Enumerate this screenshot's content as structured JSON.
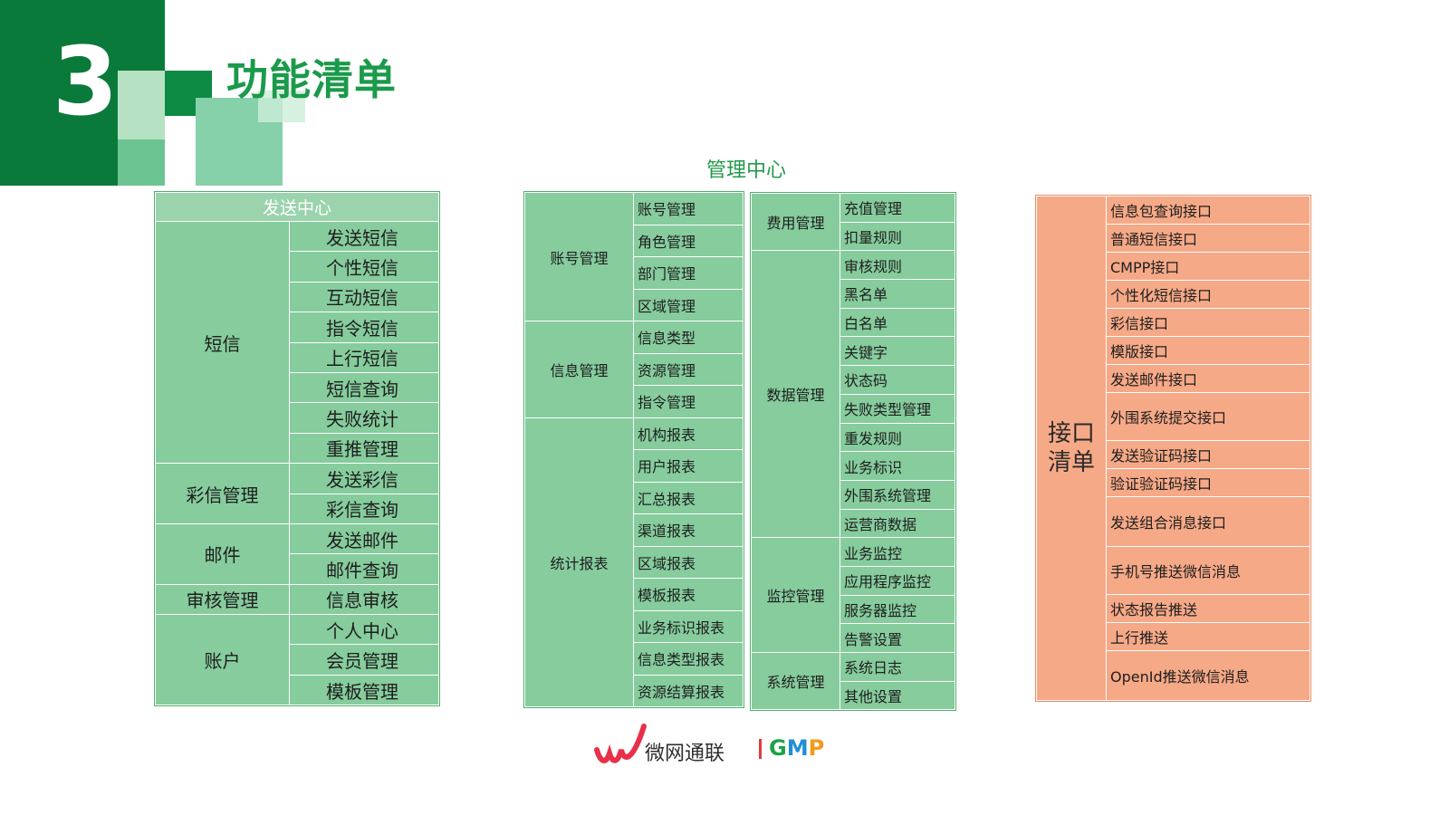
{
  "section_number": "3",
  "title": "功能清单",
  "send_center": {
    "header": "发送中心",
    "groups": [
      {
        "category": "短信",
        "items": [
          "发送短信",
          "个性短信",
          "互动短信",
          "指令短信",
          "上行短信",
          "短信查询",
          "失败统计",
          "重推管理"
        ]
      },
      {
        "category": "彩信管理",
        "items": [
          "发送彩信",
          "彩信查询"
        ]
      },
      {
        "category": "邮件",
        "items": [
          "发送邮件",
          "邮件查询"
        ]
      },
      {
        "category": "审核管理",
        "items": [
          "信息审核"
        ]
      },
      {
        "category": "账户",
        "items": [
          "个人中心",
          "会员管理",
          "模板管理"
        ]
      }
    ]
  },
  "mgmt_center": {
    "title": "管理中心",
    "left": [
      {
        "category": "账号管理",
        "items": [
          "账号管理",
          "角色管理",
          "部门管理",
          "区域管理"
        ]
      },
      {
        "category": "信息管理",
        "items": [
          "信息类型",
          "资源管理",
          "指令管理"
        ]
      },
      {
        "category": "统计报表",
        "items": [
          "机构报表",
          "用户报表",
          "汇总报表",
          "渠道报表",
          "区域报表",
          "模板报表",
          "业务标识报表",
          "信息类型报表",
          "资源结算报表"
        ]
      }
    ],
    "right": [
      {
        "category": "费用管理",
        "items": [
          "充值管理",
          "扣量规则"
        ]
      },
      {
        "category": "数据管理",
        "items": [
          "审核规则",
          "黑名单",
          "白名单",
          "关键字",
          "状态码",
          "失败类型管理",
          "重发规则",
          "业务标识",
          "外围系统管理",
          "运营商数据"
        ]
      },
      {
        "category": "监控管理",
        "items": [
          "业务监控",
          "应用程序监控",
          "服务器监控",
          "告警设置"
        ]
      },
      {
        "category": "系统管理",
        "items": [
          "系统日志",
          "其他设置"
        ]
      }
    ]
  },
  "api_list": {
    "label_line1": "接口",
    "label_line2": "清单",
    "items": [
      "信息包查询接口",
      "普通短信接口",
      "CMPP接口",
      "个性化短信接口",
      "彩信接口",
      "模版接口",
      "发送邮件接口",
      "外围系统提交接口",
      "发送验证码接口",
      "验证验证码接口",
      "发送组合消息接口",
      "手机号推送微信消息",
      "状态报告推送",
      "上行推送",
      "OpenId推送微信消息"
    ]
  },
  "brand": {
    "name": "微网通联",
    "product_letters": [
      "G",
      "M",
      "P"
    ],
    "colors": {
      "G": "#1aa34a",
      "M": "#1f8fd6",
      "P": "#f39a1a"
    }
  },
  "colors": {
    "dark_green": "#0a7a3b",
    "title_green": "#1a9a4a",
    "cell_green": "#86cc9d",
    "cell_orange": "#f6a987"
  }
}
